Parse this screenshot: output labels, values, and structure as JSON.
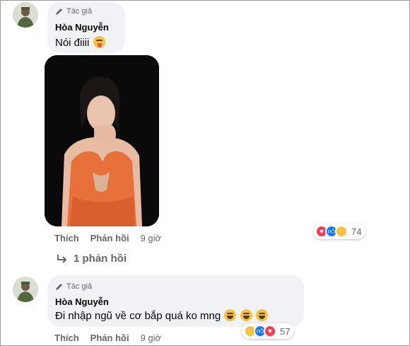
{
  "comment1": {
    "badge": "Tác giả",
    "author": "Hòa Nguyễn",
    "text": "Nói điiii",
    "emoji": "squinting-tongue-emoji",
    "actions": {
      "like": "Thích",
      "reply": "Phản hồi",
      "time": "9 giờ"
    },
    "reactions": {
      "icons": [
        "love",
        "like",
        "haha"
      ],
      "count": "74"
    },
    "replies_link": "1 phản hồi"
  },
  "comment2": {
    "badge": "Tác giả",
    "author": "Hòa Nguyễn",
    "text": "Đi nhập ngũ về cơ bắp quá ko mng",
    "emoji": "rolling-laughing-emoji",
    "actions": {
      "like": "Thích",
      "reply": "Phản hồi",
      "time": "9 giờ"
    },
    "reactions": {
      "icons": [
        "haha",
        "like",
        "love"
      ],
      "count": "57"
    }
  },
  "colors": {
    "bubble": "#f0f2f5",
    "secondary_text": "#65676b",
    "like_blue": "#1877f2",
    "love_red": "#f33e58",
    "haha_yellow": "#f7c33e",
    "dress_orange": "#e8703a"
  }
}
